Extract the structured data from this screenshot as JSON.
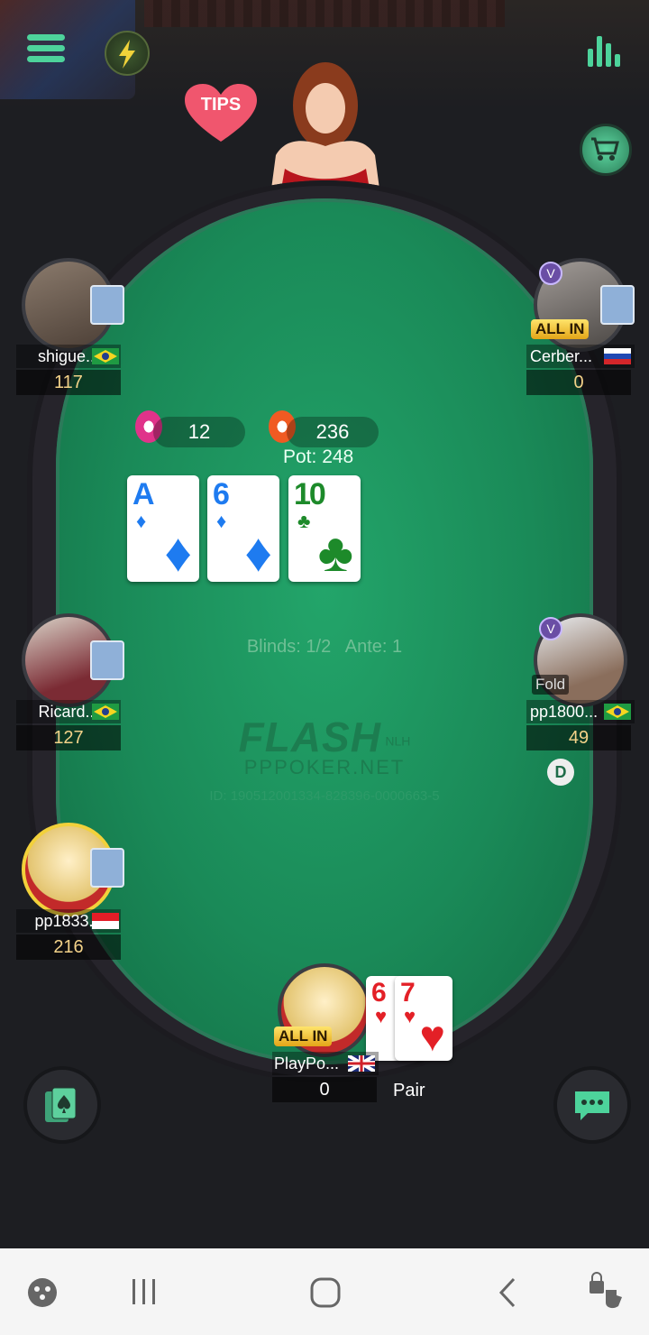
{
  "header": {
    "tips_label": "TIPS"
  },
  "table": {
    "bets": [
      "12",
      "236"
    ],
    "pot": "Pot: 248",
    "blinds": "Blinds: 1/2",
    "ante": "Ante: 1",
    "logo": "FLASH",
    "logo_sub": "NLH",
    "site": "PPPOKER.NET",
    "hand_id": "ID: 190512001334-828396-0000663-5",
    "dealer_button": "D",
    "community_cards": [
      {
        "rank": "A",
        "suit": "♦"
      },
      {
        "rank": "6",
        "suit": "♦"
      },
      {
        "rank": "10",
        "suit": "♣"
      }
    ]
  },
  "players": [
    {
      "name": "shigue...",
      "stack": "117",
      "flag": "Brazil"
    },
    {
      "name": "Cerber...",
      "stack": "0",
      "flag": "Russia",
      "status": "ALL IN",
      "vip": "V"
    },
    {
      "name": "Ricard...",
      "stack": "127",
      "flag": "Brazil"
    },
    {
      "name": "pp1800...",
      "stack": "49",
      "flag": "Brazil",
      "status": "Fold",
      "vip": "V"
    },
    {
      "name": "pp1833...",
      "stack": "216",
      "flag": "Indonesia"
    },
    {
      "name": "PlayPo...",
      "stack": "0",
      "flag": "United Kingdom",
      "status": "ALL IN"
    }
  ],
  "hero": {
    "hole_cards": [
      {
        "rank": "6",
        "suit": "♥"
      },
      {
        "rank": "7",
        "suit": "♥"
      }
    ],
    "hand_rank": "Pair"
  },
  "colors": {
    "felt": "#1a8a58",
    "accent": "#4dd39b",
    "stack": "#f3d289"
  },
  "icons": [
    "menu-icon",
    "flash-icon",
    "stats-icon",
    "cart-icon",
    "cards-icon",
    "chat-icon"
  ]
}
